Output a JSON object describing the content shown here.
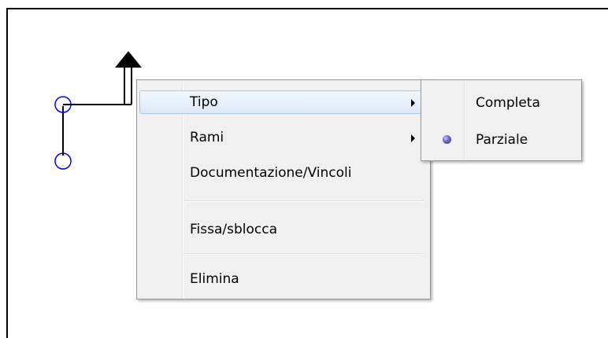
{
  "context_menu": {
    "items": [
      {
        "label": "Tipo",
        "has_submenu": true,
        "highlighted": true
      },
      {
        "label": "Rami",
        "has_submenu": true,
        "highlighted": false
      },
      {
        "label": "Documentazione/Vincoli",
        "has_submenu": false,
        "highlighted": false
      },
      {
        "label": "Fissa/sblocca",
        "has_submenu": false,
        "highlighted": false
      },
      {
        "label": "Elimina",
        "has_submenu": false,
        "highlighted": false
      }
    ]
  },
  "submenu": {
    "items": [
      {
        "label": "Completa",
        "selected": false
      },
      {
        "label": "Parziale",
        "selected": true
      }
    ]
  },
  "diagram": {
    "node_color": "#0000ff",
    "line_color": "#000000",
    "arrow_icon": "arrow-up-icon"
  }
}
